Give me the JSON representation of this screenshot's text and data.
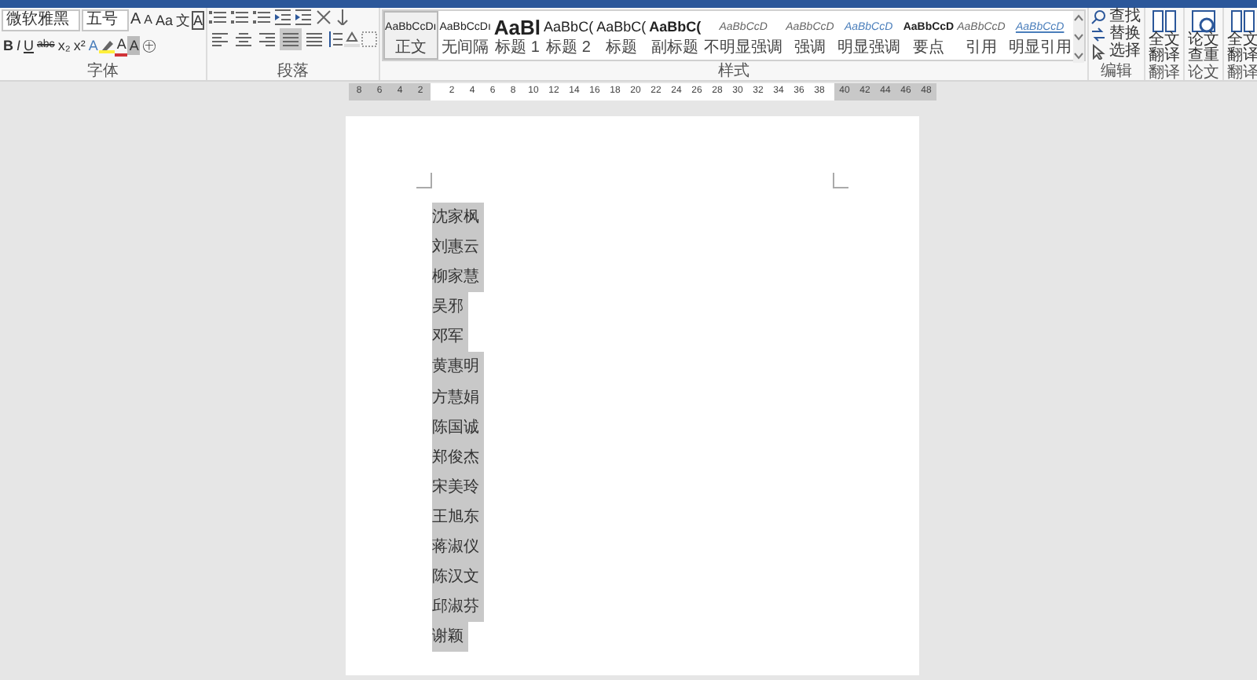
{
  "ribbon": {
    "font_group": {
      "label": "字体",
      "font_name": "微软雅黑",
      "font_size": "五号",
      "row1_buttons": [
        {
          "kind": "grow",
          "label": "A"
        },
        {
          "kind": "shrink",
          "label": "A"
        },
        {
          "kind": "case",
          "label": "Aa"
        },
        {
          "kind": "plain",
          "label": "文"
        },
        {
          "kind": "boxed",
          "label": "A"
        }
      ],
      "row2_buttons": [
        {
          "kind": "bold",
          "label": "B"
        },
        {
          "kind": "italic",
          "label": "I"
        },
        {
          "kind": "underline",
          "label": "U"
        },
        {
          "kind": "strike",
          "label": "abc"
        },
        {
          "kind": "plain",
          "label": "x₂"
        },
        {
          "kind": "plain",
          "label": "x²"
        },
        {
          "kind": "outline",
          "label": "A"
        },
        {
          "kind": "font-color",
          "label": "A",
          "color": "#d13438"
        },
        {
          "kind": "shaded",
          "label": "A"
        },
        {
          "kind": "plain",
          "label": "㊉"
        }
      ]
    },
    "paragraph_group": {
      "label": "段落",
      "alignment": [
        {
          "selected": false
        },
        {
          "selected": false
        },
        {
          "selected": false
        },
        {
          "selected": true
        },
        {
          "selected": false
        }
      ]
    },
    "styles_group": {
      "label": "样式",
      "styles": [
        {
          "preview": "AaBbCcDı",
          "label": "正文",
          "kind": "normal",
          "selected": true
        },
        {
          "preview": "AaBbCcDı",
          "label": "无间隔",
          "kind": "normal",
          "selected": false
        },
        {
          "preview": "AaBl",
          "label": "标题 1",
          "kind": "heading1",
          "selected": false
        },
        {
          "preview": "AaBbC(",
          "label": "标题 2",
          "kind": "heading",
          "selected": false
        },
        {
          "preview": "AaBbC(",
          "label": "标题",
          "kind": "heading",
          "selected": false
        },
        {
          "preview": "AaBbC(",
          "label": "副标题",
          "kind": "subtitle",
          "selected": false
        },
        {
          "preview": "AaBbCcD",
          "label": "不明显强调",
          "kind": "italic",
          "selected": false
        },
        {
          "preview": "AaBbCcD",
          "label": "强调",
          "kind": "italic",
          "selected": false
        },
        {
          "preview": "AaBbCcD",
          "label": "明显强调",
          "kind": "accent",
          "selected": false
        },
        {
          "preview": "AaBbCcD",
          "label": "要点",
          "kind": "bold",
          "selected": false
        },
        {
          "preview": "AaBbCcD",
          "label": "引用",
          "kind": "italic",
          "selected": false
        },
        {
          "preview": "AaBbCcD",
          "label": "明显引用",
          "kind": "link",
          "selected": false
        }
      ]
    },
    "editing_group": {
      "label": "编辑",
      "items": [
        {
          "label": "查找",
          "kind": "find"
        },
        {
          "label": "替换",
          "kind": "replace"
        },
        {
          "label": "选择",
          "kind": "select"
        }
      ]
    },
    "tool_groups": [
      {
        "button": "全文翻译",
        "label": "翻译",
        "kind": "translate"
      },
      {
        "button": "论文查重",
        "label": "论文",
        "kind": "check"
      },
      {
        "button": "全文翻译",
        "label": "翻译",
        "kind": "translate"
      }
    ]
  },
  "ruler": {
    "left_numbers": [
      "8",
      "6",
      "4",
      "2"
    ],
    "numbers": [
      "2",
      "4",
      "6",
      "8",
      "10",
      "12",
      "14",
      "16",
      "18",
      "20",
      "22",
      "24",
      "26",
      "28",
      "30",
      "32",
      "34",
      "36",
      "38"
    ],
    "right_numbers": [
      "40",
      "42",
      "44",
      "46",
      "48"
    ]
  },
  "document": {
    "lines": [
      {
        "text": "沈家枫",
        "highlighted": true
      },
      {
        "text": "刘惠云",
        "highlighted": true
      },
      {
        "text": "柳家慧",
        "highlighted": true
      },
      {
        "text": "吴邪",
        "highlighted": true
      },
      {
        "text": "邓军",
        "highlighted": true
      },
      {
        "text": "黄惠明",
        "highlighted": true
      },
      {
        "text": "方慧娟",
        "highlighted": true
      },
      {
        "text": "陈国诚",
        "highlighted": true
      },
      {
        "text": "郑俊杰",
        "highlighted": true
      },
      {
        "text": "宋美玲",
        "highlighted": true
      },
      {
        "text": "王旭东",
        "highlighted": true
      },
      {
        "text": "蒋淑仪",
        "highlighted": true
      },
      {
        "text": "陈汉文",
        "highlighted": true
      },
      {
        "text": "邱淑芬",
        "highlighted": true
      },
      {
        "text": "谢颖",
        "highlighted": true
      }
    ]
  }
}
